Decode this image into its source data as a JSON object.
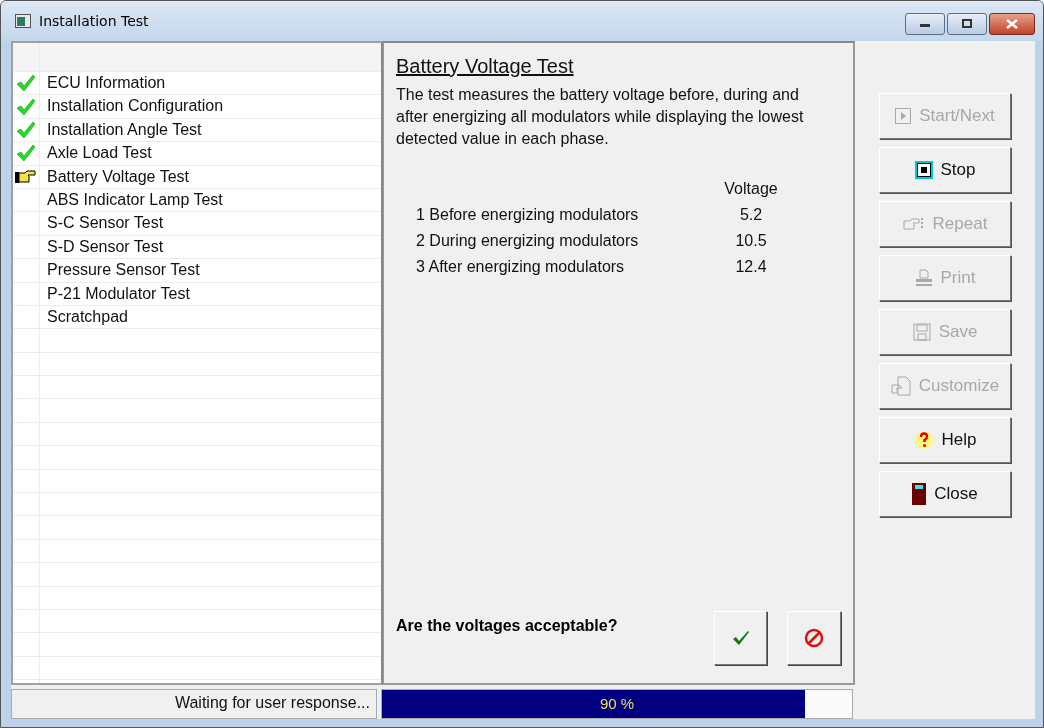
{
  "window": {
    "title": "Installation Test"
  },
  "steps": [
    {
      "label": "ECU Information",
      "kind": "done"
    },
    {
      "label": "Installation Configuration",
      "kind": "done"
    },
    {
      "label": "Installation Angle Test",
      "kind": "done"
    },
    {
      "label": "Axle Load Test",
      "kind": "done"
    },
    {
      "label": "Battery Voltage Test",
      "kind": "current"
    },
    {
      "label": "ABS Indicator Lamp Test",
      "kind": "pending"
    },
    {
      "label": "S-C Sensor Test",
      "kind": "pending"
    },
    {
      "label": "S-D Sensor Test",
      "kind": "pending"
    },
    {
      "label": "Pressure Sensor Test",
      "kind": "pending"
    },
    {
      "label": "P-21 Modulator Test",
      "kind": "pending"
    },
    {
      "label": "Scratchpad",
      "kind": "pending"
    }
  ],
  "test": {
    "title": "Battery Voltage Test",
    "description": "The test measures the battery voltage before, during and after energizing all modulators while displaying the lowest detected value in each phase.",
    "column_header": "Voltage",
    "rows": [
      {
        "label": "1 Before energizing modulators",
        "value": "5.2"
      },
      {
        "label": "2 During energizing modulators",
        "value": "10.5"
      },
      {
        "label": "3 After energizing modulators",
        "value": "12.4"
      }
    ],
    "question": "Are the voltages acceptable?"
  },
  "actions": [
    {
      "label": "Start/Next",
      "kind": "play",
      "disabled": true
    },
    {
      "label": "Stop",
      "kind": "stop",
      "disabled": false
    },
    {
      "label": "Repeat",
      "kind": "repeat",
      "disabled": true
    },
    {
      "label": "Print",
      "kind": "print",
      "disabled": true
    },
    {
      "label": "Save",
      "kind": "save",
      "disabled": true
    },
    {
      "label": "Customize",
      "kind": "customize",
      "disabled": true
    },
    {
      "label": "Help",
      "kind": "help",
      "disabled": false
    },
    {
      "label": "Close",
      "kind": "close",
      "disabled": false
    }
  ],
  "status_bar": {
    "message": "Waiting for user response...",
    "progress": {
      "level": 0.9,
      "reading": "90 %"
    }
  }
}
